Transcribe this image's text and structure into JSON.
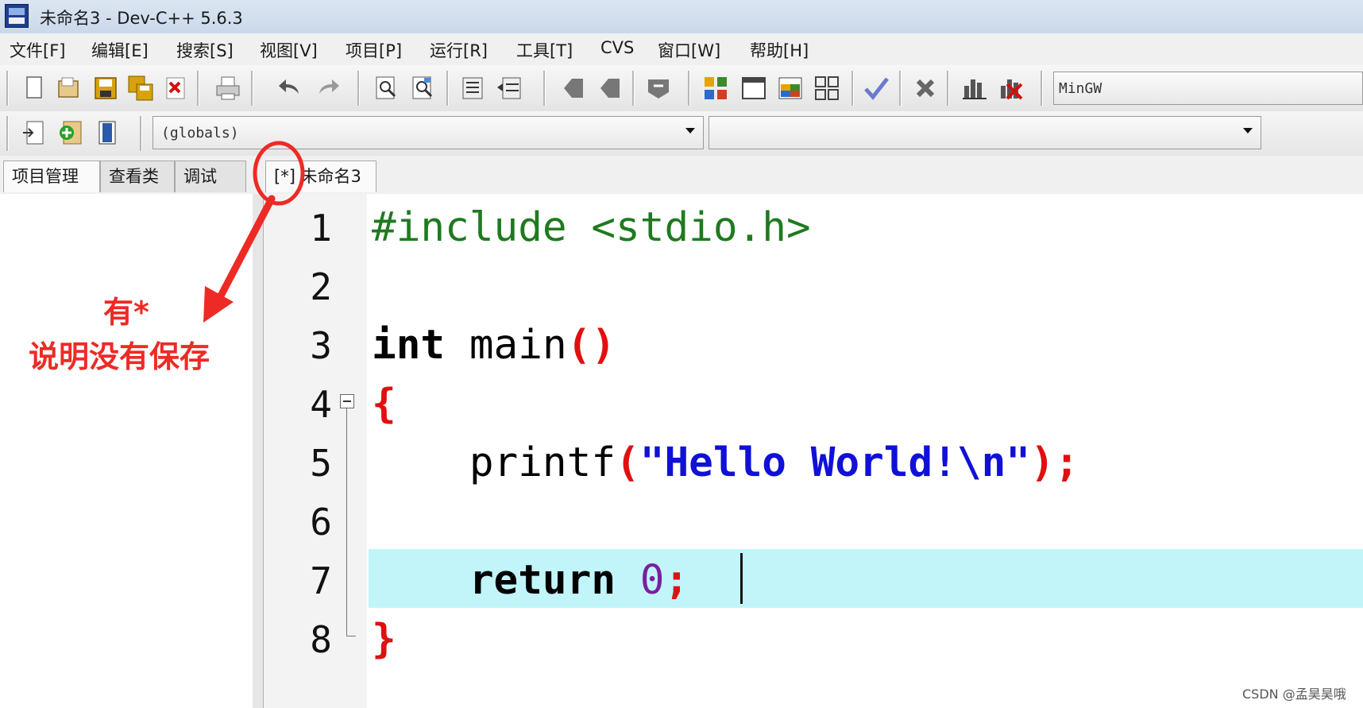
{
  "window": {
    "title": "未命名3 - Dev-C++ 5.6.3"
  },
  "menu": [
    "文件[F]",
    "编辑[E]",
    "搜索[S]",
    "视图[V]",
    "项目[P]",
    "运行[R]",
    "工具[T]",
    "CVS",
    "窗口[W]",
    "帮助[H]"
  ],
  "toolbar": {
    "compiler": "MinGW",
    "globals_combo": "(globals)",
    "members_combo": ""
  },
  "left_tabs": [
    "项目管理",
    "查看类",
    "调试"
  ],
  "editor_tab": "[*] 未命名3",
  "line_numbers": [
    "1",
    "2",
    "3",
    "4",
    "5",
    "6",
    "7",
    "8"
  ],
  "code": {
    "l1": "#include <stdio.h>",
    "l3_type": "int",
    "l3_name": " main",
    "l3_paren": "()",
    "l4": "{",
    "l5_fn": "    printf",
    "l5_open": "(",
    "l5_str": "\"Hello World!\\n\"",
    "l5_close": ");",
    "l7_kw": "    return",
    "l7_num": " 0",
    "l7_semi": ";",
    "l8": "}"
  },
  "annotation": {
    "line1": "有*",
    "line2": "说明没有保存"
  },
  "watermark": "CSDN @孟昊昊哦",
  "colors": {
    "annotation": "#ee2a24",
    "current_line": "#c1f5fa"
  }
}
